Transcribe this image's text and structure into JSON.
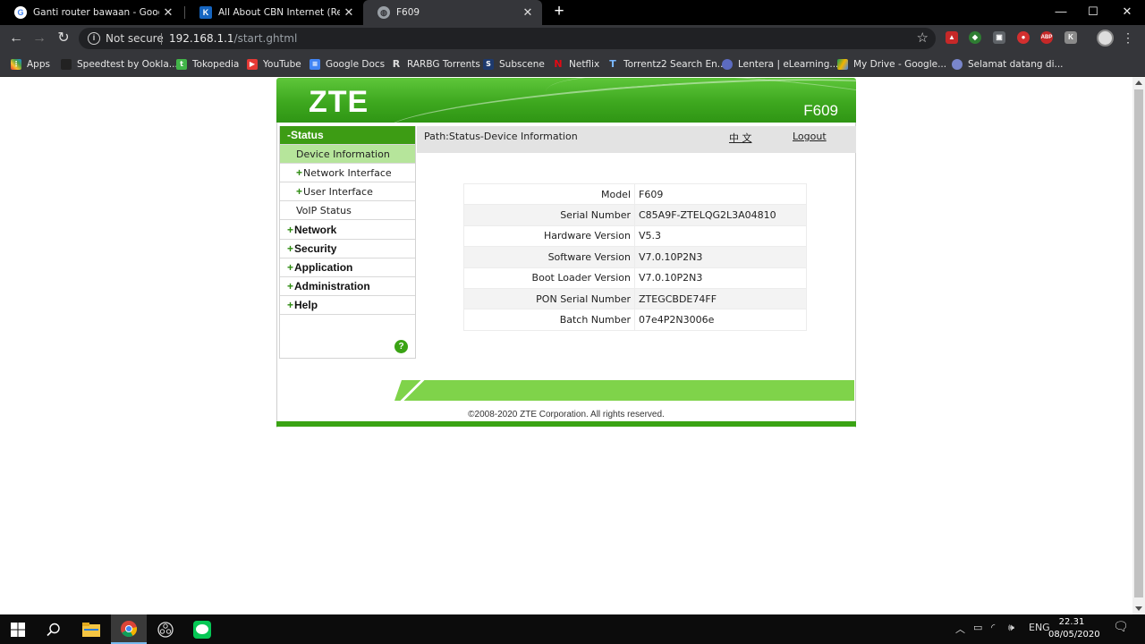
{
  "browser": {
    "tabs": [
      {
        "title": "Ganti router bawaan - Google Se",
        "icon": "google-icon",
        "active": false
      },
      {
        "title": "All About CBN Internet (Reborn)",
        "icon": "forum-icon",
        "active": false
      },
      {
        "title": "F609",
        "icon": "globe-icon",
        "active": true
      }
    ],
    "new_tab": "+",
    "window_controls": {
      "minimize": "—",
      "maximize": "☐",
      "close": "✕"
    },
    "security_label": "Not secure",
    "url_host": "192.168.1.1",
    "url_path": "/start.ghtml",
    "bookmarks": [
      {
        "label": "Apps",
        "icon": "apps-grid-icon"
      },
      {
        "label": "Speedtest by Ookla...",
        "icon": "speedtest-icon"
      },
      {
        "label": "Tokopedia",
        "icon": "tokopedia-icon"
      },
      {
        "label": "YouTube",
        "icon": "youtube-icon"
      },
      {
        "label": "Google Docs",
        "icon": "google-docs-icon"
      },
      {
        "label": "RARBG Torrents",
        "icon": "rarbg-icon"
      },
      {
        "label": "Subscene",
        "icon": "subscene-icon"
      },
      {
        "label": "Netflix",
        "icon": "netflix-icon"
      },
      {
        "label": "Torrentz2 Search En...",
        "icon": "torrentz-icon"
      },
      {
        "label": "Lentera | eLearning...",
        "icon": "lentera-icon"
      },
      {
        "label": "My Drive - Google...",
        "icon": "google-drive-icon"
      },
      {
        "label": "Selamat datang di...",
        "icon": "globe-icon"
      }
    ]
  },
  "router": {
    "brand": "ZTE",
    "model": "F609",
    "menu": {
      "status_header": "-Status",
      "status_items": [
        "Device Information",
        "Network Interface",
        "User Interface",
        "VoIP Status"
      ],
      "sections": [
        "Network",
        "Security",
        "Application",
        "Administration",
        "Help"
      ]
    },
    "path": "Path:Status-Device Information",
    "language_link": "中 文",
    "logout": "Logout",
    "device_info": [
      {
        "label": "Model",
        "value": "F609"
      },
      {
        "label": "Serial Number",
        "value": "C85A9F-ZTELQG2L3A04810"
      },
      {
        "label": "Hardware Version",
        "value": "V5.3"
      },
      {
        "label": "Software Version",
        "value": "V7.0.10P2N3"
      },
      {
        "label": "Boot Loader Version",
        "value": "V7.0.10P2N3"
      },
      {
        "label": "PON Serial Number",
        "value": "ZTEGCBDE74FF"
      },
      {
        "label": "Batch Number",
        "value": "07e4P2N3006e"
      }
    ],
    "copyright": "©2008-2020 ZTE Corporation. All rights reserved."
  },
  "taskbar": {
    "apps": [
      "windows-start-icon",
      "search-icon",
      "file-explorer-icon",
      "chrome-icon",
      "obs-icon",
      "line-icon"
    ],
    "language": "ENG",
    "time": "22.31",
    "date": "08/05/2020"
  },
  "colors": {
    "zte_green": "#3d9c14",
    "menu_selected": "#b6e59b",
    "footer_green": "#7fd34a"
  }
}
